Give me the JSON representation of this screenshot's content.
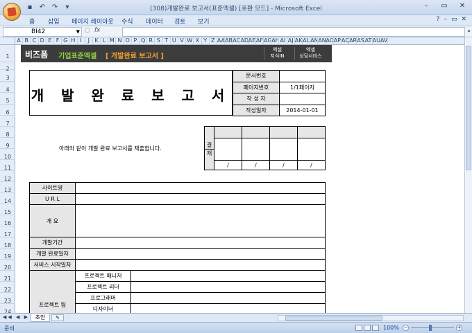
{
  "window": {
    "title": "(308)개발완료 보고서(표준엑셀) [호환 모드] - Microsoft Excel",
    "minimize": "–",
    "maximize": "▭",
    "close": "✕"
  },
  "ribbon": {
    "tabs": [
      "홈",
      "삽입",
      "페이지 레이아웃",
      "수식",
      "데이터",
      "검토",
      "보기"
    ],
    "help": "?",
    "doc_minimize": "–",
    "doc_restore": "▭",
    "doc_close": "✕"
  },
  "formula": {
    "name_box": "BI42",
    "fx": "fx",
    "value": ""
  },
  "columns": [
    "A",
    "B",
    "C",
    "D",
    "E",
    "F",
    "G",
    "H",
    "I",
    "J",
    "K",
    "L",
    "M",
    "N",
    "O",
    "P",
    "Q",
    "R",
    "S",
    "T",
    "U",
    "V",
    "W",
    "X",
    "Y",
    "Z",
    "AA",
    "AB",
    "AC",
    "AD",
    "AE",
    "AF",
    "AG",
    "AH",
    "AI",
    "AJ",
    "AK",
    "AL",
    "AM",
    "AN",
    "AO",
    "AP",
    "AQ",
    "AR",
    "AS",
    "AT",
    "AU",
    "AV"
  ],
  "rows": [
    "1",
    "2",
    "3",
    "4",
    "5",
    "6",
    "7",
    "8",
    "9",
    "10",
    "11",
    "12",
    "13",
    "14",
    "15",
    "16",
    "17",
    "18",
    "19",
    "20",
    "21",
    "22",
    "23",
    "24"
  ],
  "banner": {
    "brand": "비즈폼",
    "brand2": "기업표준엑셀",
    "doc_title": "[ 개발완료 보고서 ]",
    "btn1_line1": "엑셀",
    "btn1_line2": "지식IN",
    "btn2_line1": "엑셀",
    "btn2_line2": "상담서비스"
  },
  "document": {
    "title": "개 발 완 료 보 고 서",
    "info": [
      {
        "label": "문서번호",
        "value": ""
      },
      {
        "label": "페이지번호",
        "value": "1/1페이지"
      },
      {
        "label": "작 성 자",
        "value": ""
      },
      {
        "label": "작성일자",
        "value": "2014-01-01"
      }
    ],
    "notice": "아래와 같이 개발 완료 보고서를 제출합니다.",
    "approval_label_top": "결",
    "approval_label_bottom": "재",
    "approval_slash": "/",
    "form": [
      {
        "label": "사이트명"
      },
      {
        "label": "U  R  L"
      },
      {
        "label": "개      요"
      },
      {
        "label": "개발기간"
      },
      {
        "label": "개발 완료일자"
      },
      {
        "label": "서비스 시작일자"
      }
    ],
    "team_label": "프로젝트 팀",
    "team_roles": [
      "프로젝트 매니저",
      "프로젝트 리더",
      "프로그래머",
      "디자이너"
    ]
  },
  "sheets": {
    "active": "초안",
    "nav": "◀◀ ◀ ▶ ▶▶"
  },
  "status": {
    "ready": "준비",
    "zoom": "100%",
    "zoom_minus": "−",
    "zoom_plus": "+"
  }
}
